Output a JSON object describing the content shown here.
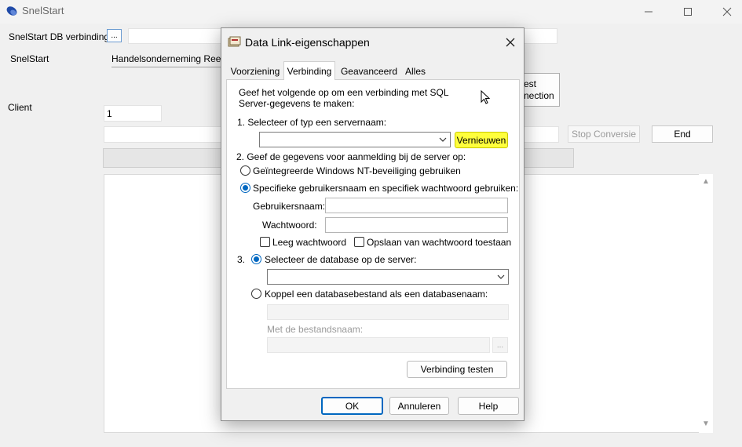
{
  "app": {
    "title": "SnelStart",
    "db_connection_label": "SnelStart DB verbinding",
    "browse_label": "...",
    "snelstart_label": "SnelStart",
    "snelstart_value": "Handelsonderneming Rees",
    "client_label": "Client",
    "client_value": "1",
    "test_connection_label_line1": "est",
    "test_connection_label_line2": "nection",
    "stop_conversion_label": "Stop Conversie",
    "end_label": "End"
  },
  "dialog": {
    "title": "Data Link-eigenschappen",
    "tabs": [
      "Voorziening",
      "Verbinding",
      "Geavanceerd",
      "Alles"
    ],
    "selected_tab": "Verbinding",
    "intro_line1": "Geef het volgende op om een verbinding met SQL",
    "intro_line2": "Server-gegevens te maken:",
    "step1_label": "1. Selecteer of typ een servernaam:",
    "server_value": "",
    "refresh_label": "Vernieuwen",
    "step2_label": "2. Geef de gegevens voor aanmelding bij de server op:",
    "windows_auth_label": "Geïntegreerde Windows NT-beveiliging gebruiken",
    "specific_auth_label": "Specifieke gebruikersnaam en specifiek wachtwoord gebruiken:",
    "username_label": "Gebruikersnaam:",
    "username_value": "",
    "password_label": "Wachtwoord:",
    "password_value": "",
    "blank_password_label": "Leeg wachtwoord",
    "save_password_label": "Opslaan van wachtwoord toestaan",
    "step3_number": "3.",
    "select_db_label": "Selecteer de database op de server:",
    "database_value": "",
    "attach_db_label": "Koppel een databasebestand als een databasenaam:",
    "filename_label": "Met de bestandsnaam:",
    "browse_label": "...",
    "test_connection_label": "Verbinding testen",
    "ok_label": "OK",
    "cancel_label": "Annuleren",
    "help_label": "Help"
  },
  "colors": {
    "accent": "#0067c0",
    "highlight": "#ffff3c"
  }
}
